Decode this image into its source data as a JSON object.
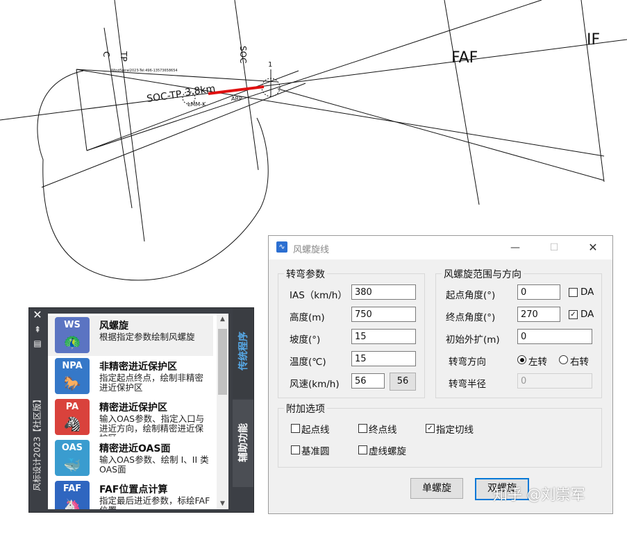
{
  "cad": {
    "labels": {
      "faf": "FAF",
      "if": "IF",
      "soc": "SOC",
      "tp": "TP",
      "c": "C",
      "tiny_header": "WindSpiral2023-Tel:496-13573658654",
      "soc_tp": "SOC-TP",
      "dist": "3.8km",
      "arp": "ARP",
      "lmm": "LMM-K",
      "one": "1"
    },
    "colors": {
      "line": "#111111",
      "segment": "#e01010"
    }
  },
  "palette": {
    "vertical_title": "风标设计2023【社区版】",
    "strip_icons": [
      "close-icon",
      "pin-icon",
      "properties-icon"
    ],
    "tabs": [
      "传统程序",
      "辅助功能"
    ],
    "items": [
      {
        "code": "WS",
        "title": "风螺旋",
        "desc": "根据指定参数绘制风螺旋",
        "color": "#5b74c2",
        "glyph": "🦚"
      },
      {
        "code": "NPA",
        "title": "非精密进近保护区",
        "desc": "指定起点终点，绘制非精密进近保护区",
        "color": "#3578c8",
        "glyph": "🐎"
      },
      {
        "code": "PA",
        "title": "精密进近保护区",
        "desc": "输入OAS参数、指定入口与进近方向，绘制精密进近保护区",
        "color": "#d9423c",
        "glyph": "🦓"
      },
      {
        "code": "OAS",
        "title": "精密进近OAS面",
        "desc": "输入OAS参数、绘制 I、II 类OAS面",
        "color": "#3a9ccf",
        "glyph": "🐳"
      },
      {
        "code": "FAF",
        "title": "FAF位置点计算",
        "desc": "指定最后进近参数，标绘FAF位置",
        "color": "#2f66c0",
        "glyph": "🦄"
      }
    ]
  },
  "dialog": {
    "title": "风螺旋线",
    "window_buttons": {
      "minimize": "—",
      "maximize": "☐",
      "close": "✕"
    },
    "group_turn": {
      "title": "转弯参数",
      "fields": [
        {
          "label": "IAS（km/h）",
          "value": "380"
        },
        {
          "label": "高度(m)",
          "value": "750"
        },
        {
          "label": "坡度(°)",
          "value": "15"
        },
        {
          "label": "温度(℃)",
          "value": "15"
        },
        {
          "label": "风速(km/h)",
          "value": "56",
          "extra": "56"
        }
      ]
    },
    "group_range": {
      "title": "风螺旋范围与方向",
      "start_label": "起点角度(°)",
      "start_value": "0",
      "start_da": "DA",
      "start_da_checked": false,
      "end_label": "终点角度(°)",
      "end_value": "270",
      "end_da": "DA",
      "end_da_checked": true,
      "init_label": "初始外扩(m)",
      "init_value": "0",
      "dir_label": "转弯方向",
      "dir_left": "左转",
      "dir_right": "右转",
      "dir_selected": "left",
      "radius_label": "转弯半径",
      "radius_value": "0"
    },
    "group_extra": {
      "title": "附加选项",
      "options": [
        {
          "label": "起点线",
          "checked": false
        },
        {
          "label": "终点线",
          "checked": false
        },
        {
          "label": "指定切线",
          "checked": true
        },
        {
          "label": "基准圆",
          "checked": false
        },
        {
          "label": "虚线螺旋",
          "checked": false
        }
      ]
    },
    "buttons": {
      "single": "单螺旋",
      "double": "双螺旋"
    }
  },
  "watermark": "知乎 @刘崇军"
}
